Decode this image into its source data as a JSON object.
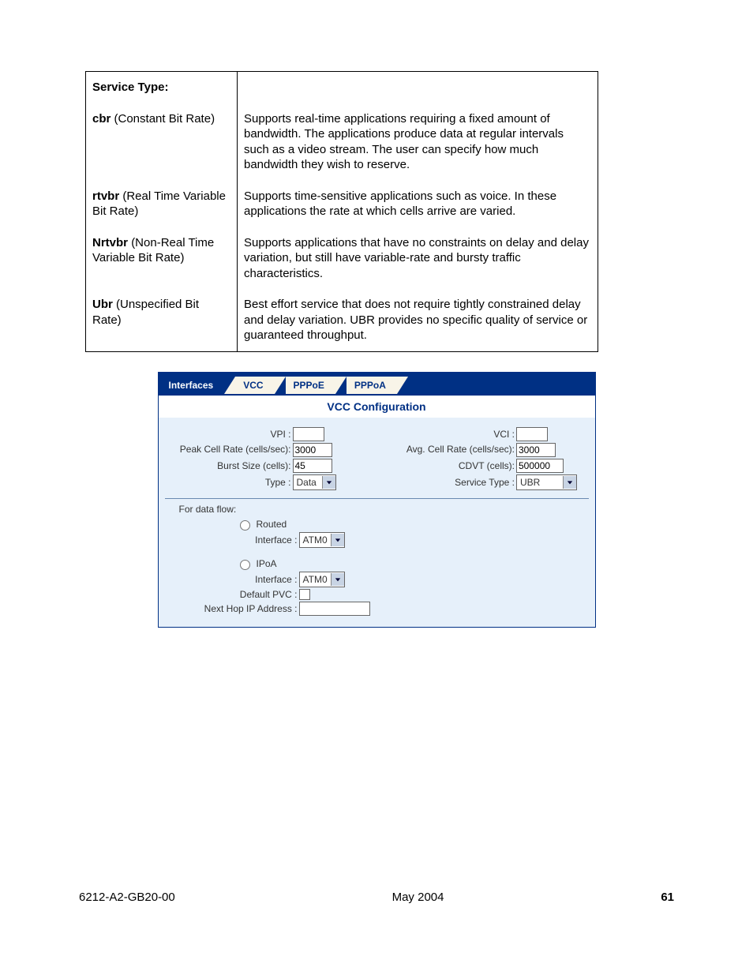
{
  "service_type": {
    "heading": "Service Type:",
    "rows": [
      {
        "abbr": "cbr",
        "name": "(Constant Bit Rate)",
        "desc": "Supports real-time applications requiring a fixed amount of bandwidth. The applications produce data at regular intervals such as a video stream. The user can specify how much bandwidth they wish to reserve."
      },
      {
        "abbr": "rtvbr",
        "name": "(Real Time Variable Bit Rate)",
        "desc": "Supports time-sensitive applications such as voice. In these applications the rate at which cells arrive are varied."
      },
      {
        "abbr": "Nrtvbr",
        "name": "(Non-Real Time Variable Bit Rate)",
        "desc": "Supports applications that have no constraints on delay and delay variation, but still have variable-rate and bursty traffic characteristics."
      },
      {
        "abbr": "Ubr",
        "name": "(Unspecified Bit Rate)",
        "desc": "Best effort service that does not require tightly constrained delay and delay variation. UBR provides no specific quality of service or guaranteed throughput."
      }
    ]
  },
  "tabs": {
    "interfaces": "Interfaces",
    "vcc": "VCC",
    "pppoe": "PPPoE",
    "pppoa": "PPPoA"
  },
  "vcc": {
    "title": "VCC Configuration",
    "labels": {
      "vpi": "VPI :",
      "vci": "VCI :",
      "peak": "Peak Cell Rate (cells/sec):",
      "avg": "Avg. Cell Rate (cells/sec):",
      "burst": "Burst Size (cells):",
      "cdvt": "CDVT (cells):",
      "type": "Type :",
      "service_type": "Service Type :",
      "for_data_flow": "For data flow:",
      "routed": "Routed",
      "ipoa": "IPoA",
      "interface": "Interface :",
      "default_pvc": "Default PVC :",
      "next_hop": "Next Hop IP Address :"
    },
    "values": {
      "vpi": "",
      "vci": "",
      "peak": "3000",
      "avg": "3000",
      "burst": "45",
      "cdvt": "500000",
      "type": "Data",
      "service_type": "UBR",
      "routed_interface": "ATM0",
      "ipoa_interface": "ATM0",
      "next_hop": ""
    }
  },
  "footer": {
    "doc_id": "6212-A2-GB20-00",
    "date": "May 2004",
    "page": "61"
  }
}
